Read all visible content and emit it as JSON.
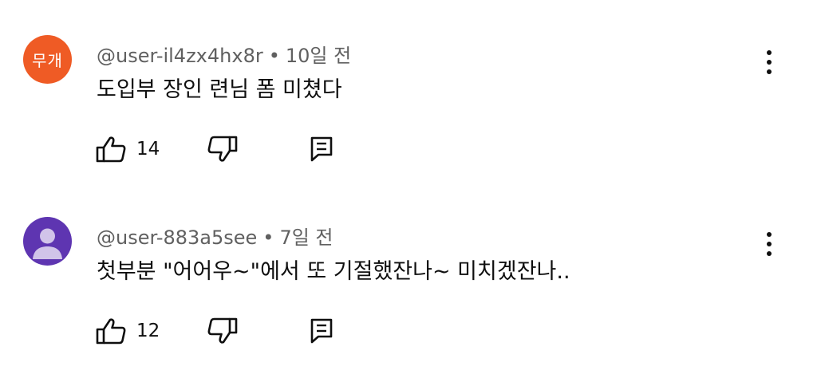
{
  "comments": [
    {
      "avatar_text": "무개",
      "avatar_color": "#ef5b25",
      "username": "@user-il4zx4hx8r",
      "separator": "•",
      "time": "10일 전",
      "text": "도입부 장인 련님 폼 미쳤다",
      "like_count": "14",
      "icons": [
        "thumbs-up-icon",
        "thumbs-down-icon",
        "reply-icon",
        "more-vert-icon"
      ]
    },
    {
      "avatar_text": "",
      "avatar_color": "#5e35b1",
      "username": "@user-883a5see",
      "separator": "•",
      "time": "7일 전",
      "text": "첫부분 \"어어우~\"에서 또 기절했잔나~ 미치겠잔나..",
      "like_count": "12",
      "icons": [
        "thumbs-up-icon",
        "thumbs-down-icon",
        "reply-icon",
        "more-vert-icon"
      ]
    }
  ]
}
